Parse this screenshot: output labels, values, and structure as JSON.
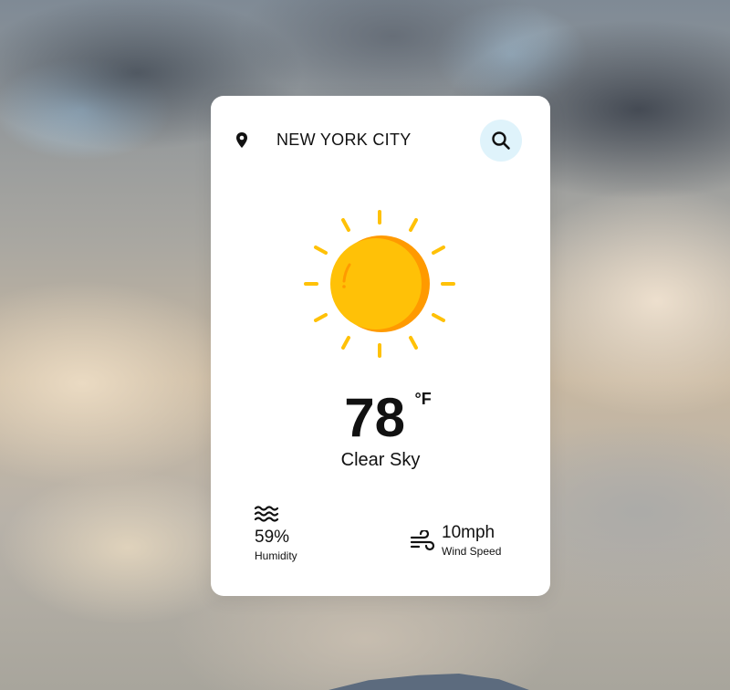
{
  "location": {
    "city": "NEW YORK CITY",
    "icon": "location-pin-icon"
  },
  "search": {
    "icon": "search-icon",
    "button_color": "#dff3fb"
  },
  "weather": {
    "icon": "sun-icon",
    "temperature": "78",
    "unit": "°F",
    "condition": "Clear Sky"
  },
  "stats": {
    "humidity": {
      "value": "59%",
      "label": "Humidity",
      "icon": "waves-icon"
    },
    "wind": {
      "value": "10mph",
      "label": "Wind Speed",
      "icon": "wind-icon"
    }
  },
  "colors": {
    "card": "#ffffff",
    "sun_main": "#ffc107",
    "sun_shade": "#ff9a00",
    "rays": "#ffc107",
    "text": "#111111"
  }
}
